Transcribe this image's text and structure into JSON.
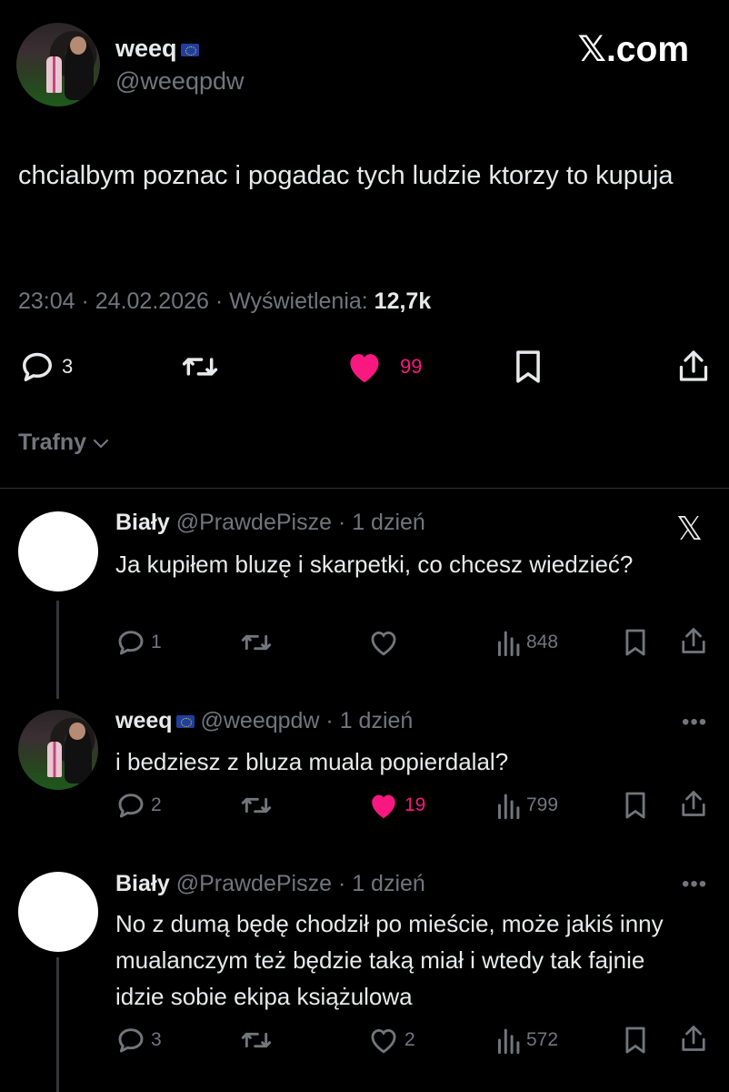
{
  "main_tweet": {
    "author_name": "weeq",
    "author_handle": "@weeqpdw",
    "brand": "𝕏.com",
    "text": "chcialbym poznac i pogadac tych ludzie ktorzy to kupuja",
    "meta_time": "23:04 · 24.02.2026 · Wyświetlenia: ",
    "views": "12,7k",
    "replies": "3",
    "likes": "99"
  },
  "sort_label": "Trafny",
  "replies": [
    {
      "author_name": "Biały",
      "meta": "@PrawdePisze · 1 dzień",
      "text": "Ja kupiłem bluzę i skarpetki, co chcesz wiedzieć?",
      "replies": "1",
      "likes": "",
      "views": "848",
      "liked": false
    },
    {
      "author_name": "weeq",
      "meta": "@weeqpdw · 1 dzień",
      "text": "i bedziesz z bluza muala popierdalal?",
      "replies": "2",
      "likes": "19",
      "views": "799",
      "liked": true
    },
    {
      "author_name": "Biały",
      "meta": "@PrawdePisze · 1 dzień",
      "text": "No z dumą będę chodził po mieście, może jakiś inny mualanczym też będzie taką miał i wtedy tak fajnie idzie sobie ekipa książulowa",
      "replies": "3",
      "likes": "2",
      "views": "572",
      "liked": false
    }
  ],
  "colors": {
    "background": "#000000",
    "text": "#e7e9ea",
    "muted": "#71767b",
    "like": "#f91880",
    "line": "#333639"
  }
}
